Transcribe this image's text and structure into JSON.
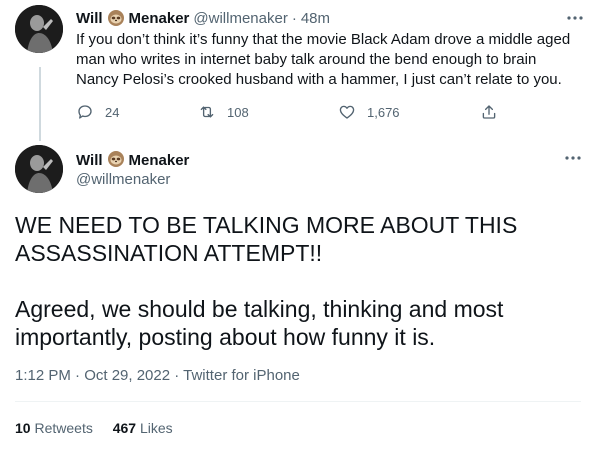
{
  "reply_tweet": {
    "author_name": "Will",
    "author_name_suffix": "Menaker",
    "author_emoji": "sloth-emoji",
    "handle": "@willmenaker",
    "separator": "·",
    "time": "48m",
    "text": "If you don’t think it’s funny that the movie Black Adam drove a middle aged man who writes in internet baby talk around the bend enough to brain Nancy Pelosi’s crooked husband with a hammer, I just can’t relate to you.",
    "actions": {
      "reply_count": "24",
      "retweet_count": "108",
      "like_count": "1,676"
    }
  },
  "main_tweet": {
    "author_name": "Will",
    "author_name_suffix": "Menaker",
    "handle": "@willmenaker",
    "text_line1": "WE NEED TO BE TALKING MORE ABOUT THIS ASSASSINATION ATTEMPT!!",
    "text_line2": "Agreed, we should be talking, thinking and most importantly, posting about how funny it is.",
    "timestamp": "1:12 PM · Oct 29, 2022 · Twitter for iPhone",
    "retweets_count": "10",
    "retweets_label": "Retweets",
    "likes_count": "467",
    "likes_label": "Likes"
  },
  "colors": {
    "text": "#0f1419",
    "secondary": "#536471",
    "divider": "#eff3f4",
    "thread_line": "#cfd9de"
  }
}
